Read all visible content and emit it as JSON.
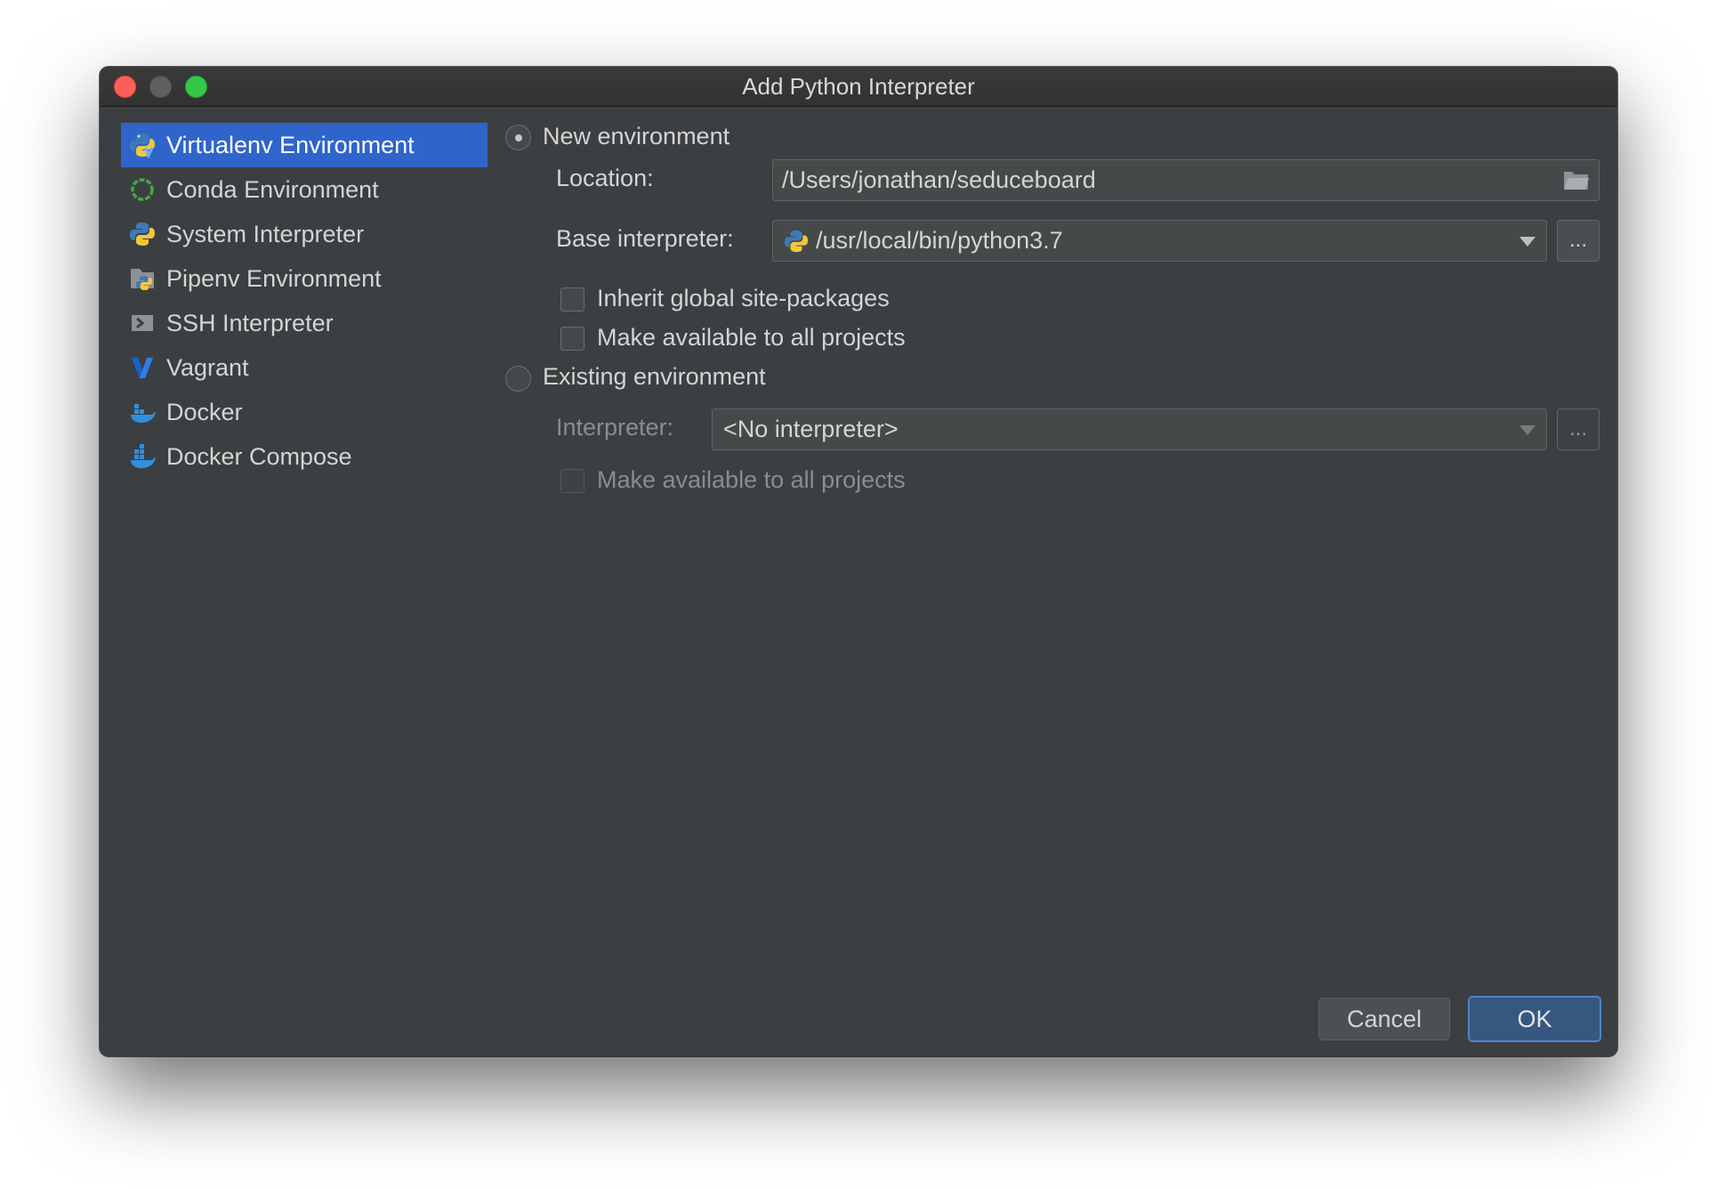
{
  "window": {
    "title": "Add Python Interpreter"
  },
  "sidebar": {
    "items": [
      {
        "label": "Virtualenv Environment",
        "icon": "virtualenv-python-icon",
        "selected": true
      },
      {
        "label": "Conda Environment",
        "icon": "conda-icon"
      },
      {
        "label": "System Interpreter",
        "icon": "python-icon"
      },
      {
        "label": "Pipenv Environment",
        "icon": "pipenv-icon"
      },
      {
        "label": "SSH Interpreter",
        "icon": "ssh-terminal-icon"
      },
      {
        "label": "Vagrant",
        "icon": "vagrant-icon"
      },
      {
        "label": "Docker",
        "icon": "docker-icon"
      },
      {
        "label": "Docker Compose",
        "icon": "docker-compose-icon"
      }
    ]
  },
  "new_env": {
    "radio_label": "New environment",
    "selected": true,
    "location_label": "Location:",
    "location_value": "/Users/jonathan/seduceboard",
    "base_label": "Base interpreter:",
    "base_value": "/usr/local/bin/python3.7",
    "inherit_label": "Inherit global site-packages",
    "make_available_label": "Make available to all projects",
    "ellipsis": "..."
  },
  "existing_env": {
    "radio_label": "Existing environment",
    "selected": false,
    "interpreter_label": "Interpreter:",
    "interpreter_value": "<No interpreter>",
    "make_available_label": "Make available to all projects",
    "ellipsis": "..."
  },
  "buttons": {
    "cancel": "Cancel",
    "ok": "OK"
  },
  "colors": {
    "background": "#3c3f41",
    "selection": "#2f65ca",
    "ok_border": "#4a86c7"
  }
}
